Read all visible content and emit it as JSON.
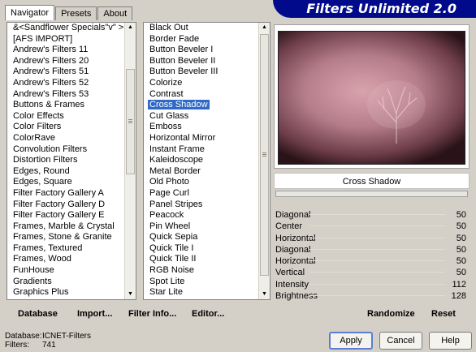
{
  "window": {
    "title": "Filters Unlimited 2.0"
  },
  "tabs": [
    {
      "label": "Navigator",
      "active": true
    },
    {
      "label": "Presets",
      "active": false
    },
    {
      "label": "About",
      "active": false
    }
  ],
  "categories": [
    "&<Sandflower Specials\"v\" >",
    "[AFS IMPORT]",
    "Andrew's Filters 11",
    "Andrew's Filters 20",
    "Andrew's Filters 51",
    "Andrew's Filters 52",
    "Andrew's Filters 53",
    "Buttons & Frames",
    "Color Effects",
    "Color Filters",
    "ColorRave",
    "Convolution Filters",
    "Distortion Filters",
    "Edges, Round",
    "Edges, Square",
    "Filter Factory Gallery A",
    "Filter Factory Gallery D",
    "Filter Factory Gallery E",
    "Frames, Marble & Crystal",
    "Frames, Stone & Granite",
    "Frames, Textured",
    "Frames, Wood",
    "FunHouse",
    "Gradients",
    "Graphics Plus"
  ],
  "filters": [
    {
      "label": "Black Out",
      "selected": false
    },
    {
      "label": "Border Fade",
      "selected": false
    },
    {
      "label": "Button Beveler I",
      "selected": false
    },
    {
      "label": "Button Beveler II",
      "selected": false
    },
    {
      "label": "Button Beveler III",
      "selected": false
    },
    {
      "label": "Colorize",
      "selected": false
    },
    {
      "label": "Contrast",
      "selected": false
    },
    {
      "label": "Cross Shadow",
      "selected": true
    },
    {
      "label": "Cut Glass",
      "selected": false
    },
    {
      "label": "Emboss",
      "selected": false
    },
    {
      "label": "Horizontal Mirror",
      "selected": false
    },
    {
      "label": "Instant Frame",
      "selected": false
    },
    {
      "label": "Kaleidoscope",
      "selected": false
    },
    {
      "label": "Metal Border",
      "selected": false
    },
    {
      "label": "Old Photo",
      "selected": false
    },
    {
      "label": "Page Curl",
      "selected": false
    },
    {
      "label": "Panel Stripes",
      "selected": false
    },
    {
      "label": "Peacock",
      "selected": false
    },
    {
      "label": "Pin Wheel",
      "selected": false
    },
    {
      "label": "Quick Sepia",
      "selected": false
    },
    {
      "label": "Quick Tile I",
      "selected": false
    },
    {
      "label": "Quick Tile II",
      "selected": false
    },
    {
      "label": "RGB Noise",
      "selected": false
    },
    {
      "label": "Spot Lite",
      "selected": false
    },
    {
      "label": "Star Lite",
      "selected": false
    }
  ],
  "preview": {
    "filter_name": "Cross Shadow"
  },
  "params": [
    {
      "name": "Diagonal",
      "value": "50"
    },
    {
      "name": "Center",
      "value": "50"
    },
    {
      "name": "Horizontal",
      "value": "50"
    },
    {
      "name": "Diagonal",
      "value": "50"
    },
    {
      "name": "Horizontal",
      "value": "50"
    },
    {
      "name": "Vertical",
      "value": "50"
    },
    {
      "name": "Intensity",
      "value": "112"
    },
    {
      "name": "Brightness",
      "value": "128"
    }
  ],
  "toolbar": {
    "database": "Database",
    "import": "Import...",
    "filter_info": "Filter Info...",
    "editor": "Editor...",
    "randomize": "Randomize",
    "reset": "Reset"
  },
  "status": {
    "database_label": "Database:",
    "database_value": "ICNET-Filters",
    "filters_label": "Filters:",
    "filters_value": "741"
  },
  "buttons": {
    "apply": "Apply",
    "cancel": "Cancel",
    "help": "Help"
  },
  "colors": {
    "header": "#000a8a",
    "selection": "#316ac5",
    "background": "#d4d0c8"
  }
}
